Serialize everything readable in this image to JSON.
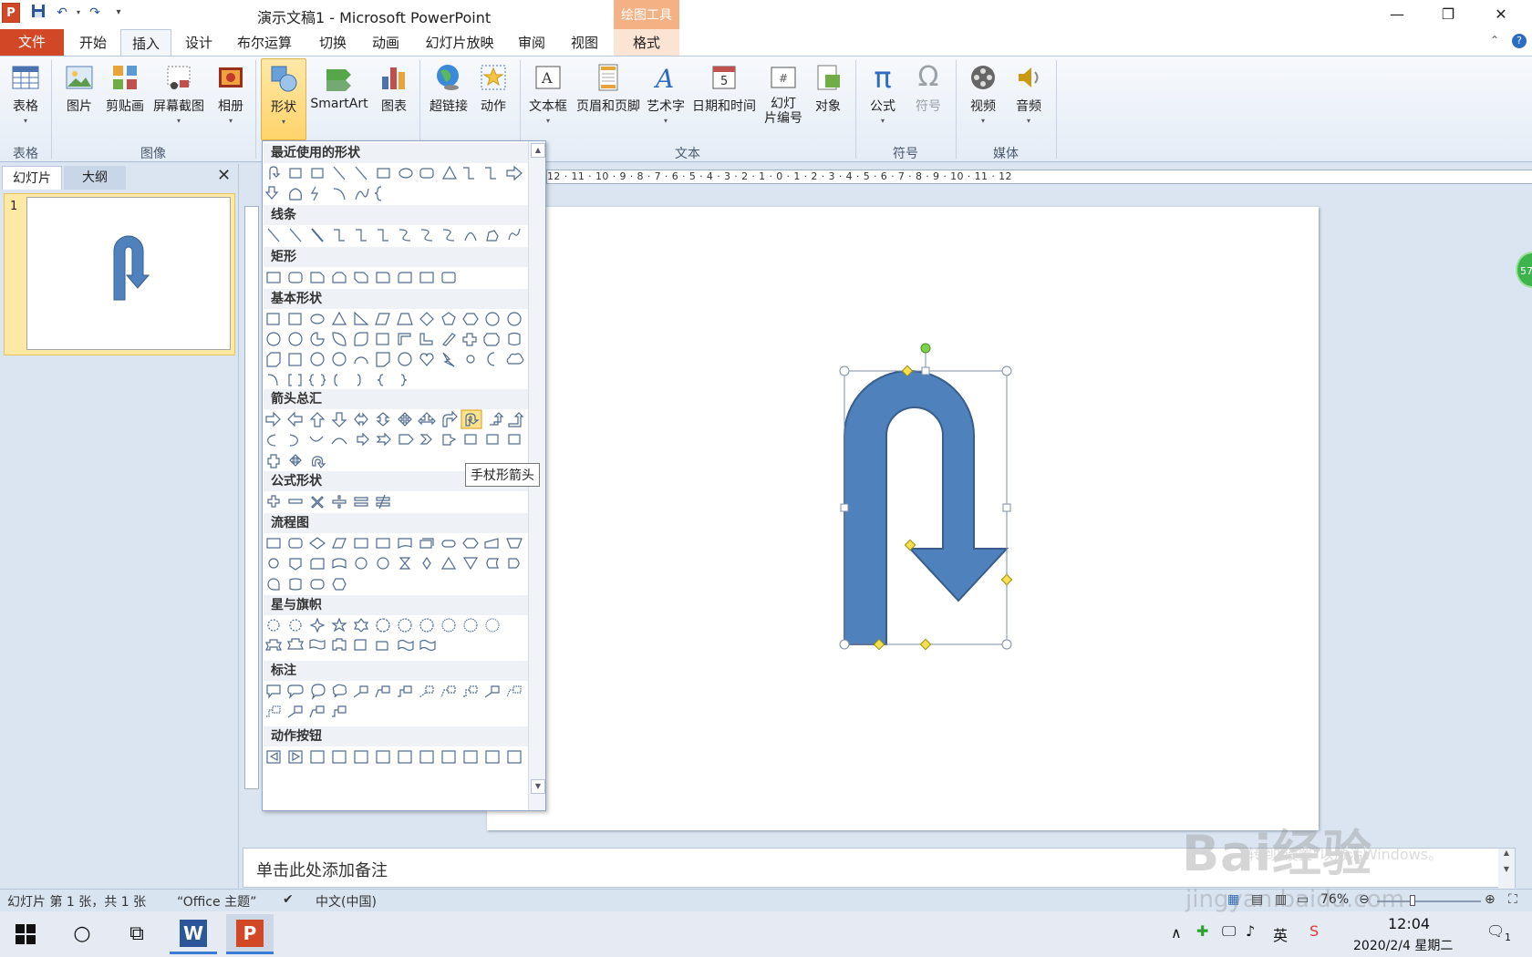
{
  "titlebar": {
    "app_logo": "P",
    "title": "演示文稿1 - Microsoft PowerPoint",
    "contextual_header": "绘图工具",
    "qat_icons": [
      "save-icon",
      "undo-icon",
      "redo-icon",
      "customize-icon"
    ],
    "window_buttons": [
      "minimize",
      "restore",
      "close"
    ]
  },
  "tabs": {
    "file": "文件",
    "items": [
      "开始",
      "插入",
      "设计",
      "布尔运算",
      "切换",
      "动画",
      "幻灯片放映",
      "审阅",
      "视图",
      "格式"
    ],
    "active": "插入"
  },
  "ribbon": {
    "table": {
      "label": "表格"
    },
    "picture": {
      "label": "图片"
    },
    "clipart": {
      "label": "剪贴画"
    },
    "screenshot": {
      "label": "屏幕截图"
    },
    "album": {
      "label": "相册"
    },
    "shapes": {
      "label": "形状"
    },
    "smartart": {
      "label": "SmartArt"
    },
    "chart": {
      "label": "图表"
    },
    "hyperlink": {
      "label": "超链接"
    },
    "action": {
      "label": "动作"
    },
    "textbox": {
      "label": "文本框"
    },
    "header_footer": {
      "label": "页眉和页脚"
    },
    "wordart": {
      "label": "艺术字"
    },
    "datetime": {
      "label": "日期和时间"
    },
    "slide_number": {
      "label_line1": "幻灯",
      "label_line2": "片编号"
    },
    "object": {
      "label": "对象"
    },
    "equation": {
      "label": "公式",
      "glyph": "π"
    },
    "symbol": {
      "label": "符号",
      "glyph": "Ω"
    },
    "video": {
      "label": "视频"
    },
    "audio": {
      "label": "音频"
    },
    "groups": {
      "tables": "表格",
      "images": "图像",
      "text": "文本",
      "symbols": "符号",
      "media": "媒体"
    }
  },
  "left_panel": {
    "tab_slides": "幻灯片",
    "tab_outline": "大纲",
    "close": "✕",
    "slide_number": "1"
  },
  "ruler": {
    "text": "12 · 11 · 10 · 9 · 8 · 7 · 6 · 5 · 4 · 3 · 2 · 1 · 0 · 1 · 2 · 3 · 4 · 5 · 6 · 7 · 8 · 9 · 10 · 11 · 12"
  },
  "shapes_dropdown": {
    "categories": {
      "recent": "最近使用的形状",
      "lines": "线条",
      "rectangles": "矩形",
      "basic": "基本形状",
      "arrows": "箭头总汇",
      "equation": "公式形状",
      "flowchart": "流程图",
      "stars": "星与旗帜",
      "callouts": "标注",
      "action_buttons": "动作按钮"
    },
    "tooltip": "手杖形箭头"
  },
  "notes": {
    "placeholder": "单击此处添加备注"
  },
  "statusbar": {
    "slide_info": "幻灯片 第 1 张，共 1 张",
    "theme": "“Office 主题”",
    "language": "中文(中国)",
    "zoom": "76%"
  },
  "taskbar": {
    "ime": "英",
    "time": "12:04",
    "date": "2020/2/4 星期二",
    "notification_count": "1"
  },
  "watermark": {
    "brand": "Bai经验",
    "url": "jingyan.baidu.com",
    "ghost_text": "转到\"设置\"以激活Windows。"
  },
  "side_badge": "57",
  "colors": {
    "accent_file": "#d24726",
    "shape_fill": "#4f81bd",
    "shape_stroke": "#385d8a",
    "contextual": "#f4b183"
  }
}
